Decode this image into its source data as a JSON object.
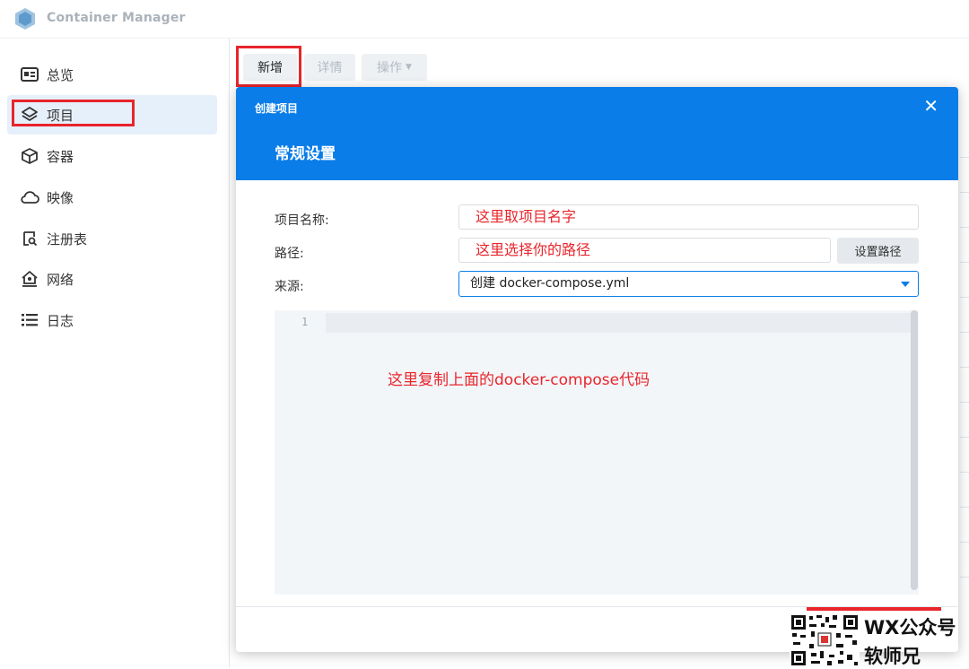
{
  "app": {
    "title": "Container Manager"
  },
  "sidebar": {
    "items": [
      {
        "label": "总览",
        "icon": "overview-icon"
      },
      {
        "label": "项目",
        "icon": "layers-icon",
        "active": true
      },
      {
        "label": "容器",
        "icon": "cube-icon"
      },
      {
        "label": "映像",
        "icon": "cloud-icon"
      },
      {
        "label": "注册表",
        "icon": "registry-search-icon"
      },
      {
        "label": "网络",
        "icon": "network-home-icon"
      },
      {
        "label": "日志",
        "icon": "list-icon"
      }
    ]
  },
  "toolbar": {
    "new_label": "新增",
    "detail_label": "详情",
    "action_label": "操作"
  },
  "modal": {
    "title": "创建项目",
    "section": "常规设置",
    "form": {
      "name_label": "项目名称:",
      "name_value": "这里取项目名字",
      "path_label": "路径:",
      "path_value": "这里选择你的路径",
      "path_button": "设置路径",
      "source_label": "来源:",
      "source_value": "创建 docker-compose.yml"
    },
    "editor": {
      "line_number": "1",
      "note": "这里复制上面的docker-compose代码"
    }
  },
  "watermark": {
    "line1": "WX公众号",
    "line2": "软师兄"
  },
  "colors": {
    "accent": "#0a7de8",
    "highlight": "#e8252b",
    "active_bg": "#e6f0fb"
  }
}
